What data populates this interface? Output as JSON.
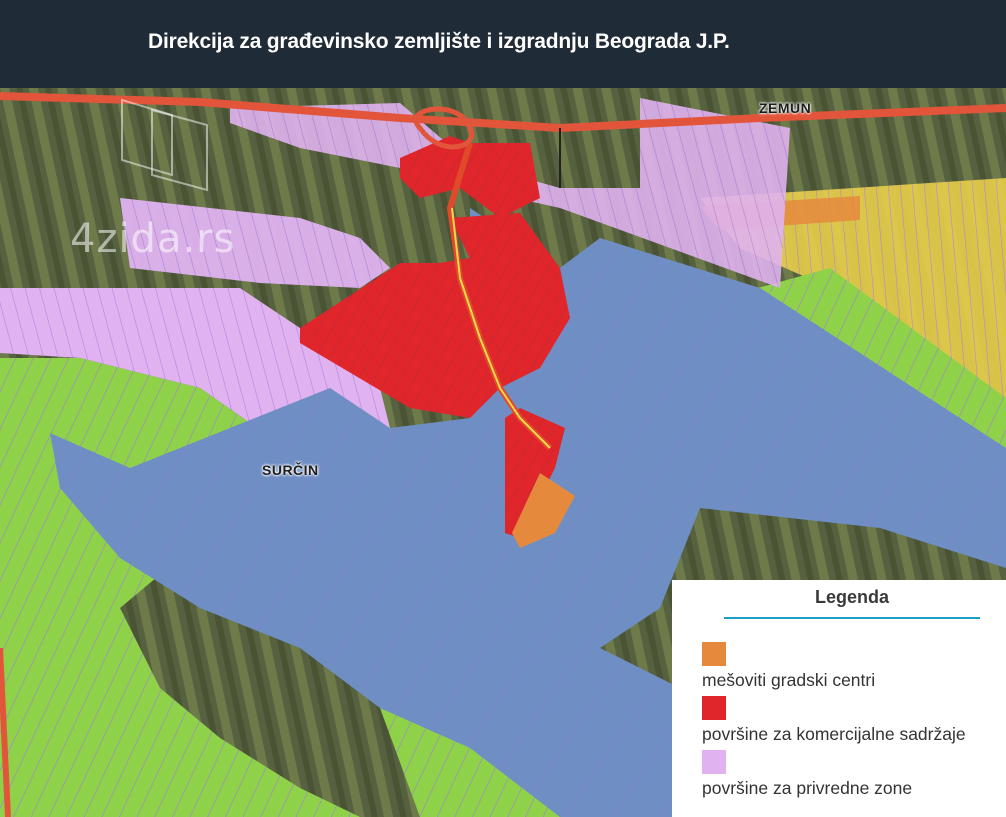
{
  "header": {
    "title": "Direkcija za građevinsko zemljište i izgradnju Beograda J.P."
  },
  "map": {
    "places": [
      "ZEMUN",
      "SURČIN"
    ],
    "watermark": "4zida.rs",
    "zone_colors": {
      "mixed_city_centers": "#e58a3d",
      "commercial": "#e0252b",
      "industrial": "#e0b3f0",
      "airport": "#6f8fc4",
      "green": "#8fd24a",
      "residential": "#e8cf4a"
    }
  },
  "legend": {
    "title": "Legenda",
    "items": [
      {
        "label": "mešoviti gradski centri",
        "color": "#e58a3d"
      },
      {
        "label": "površine za komercijalne sadržaje",
        "color": "#e0252b"
      },
      {
        "label": "površine za privredne zone",
        "color": "#e0b3f0"
      }
    ]
  }
}
